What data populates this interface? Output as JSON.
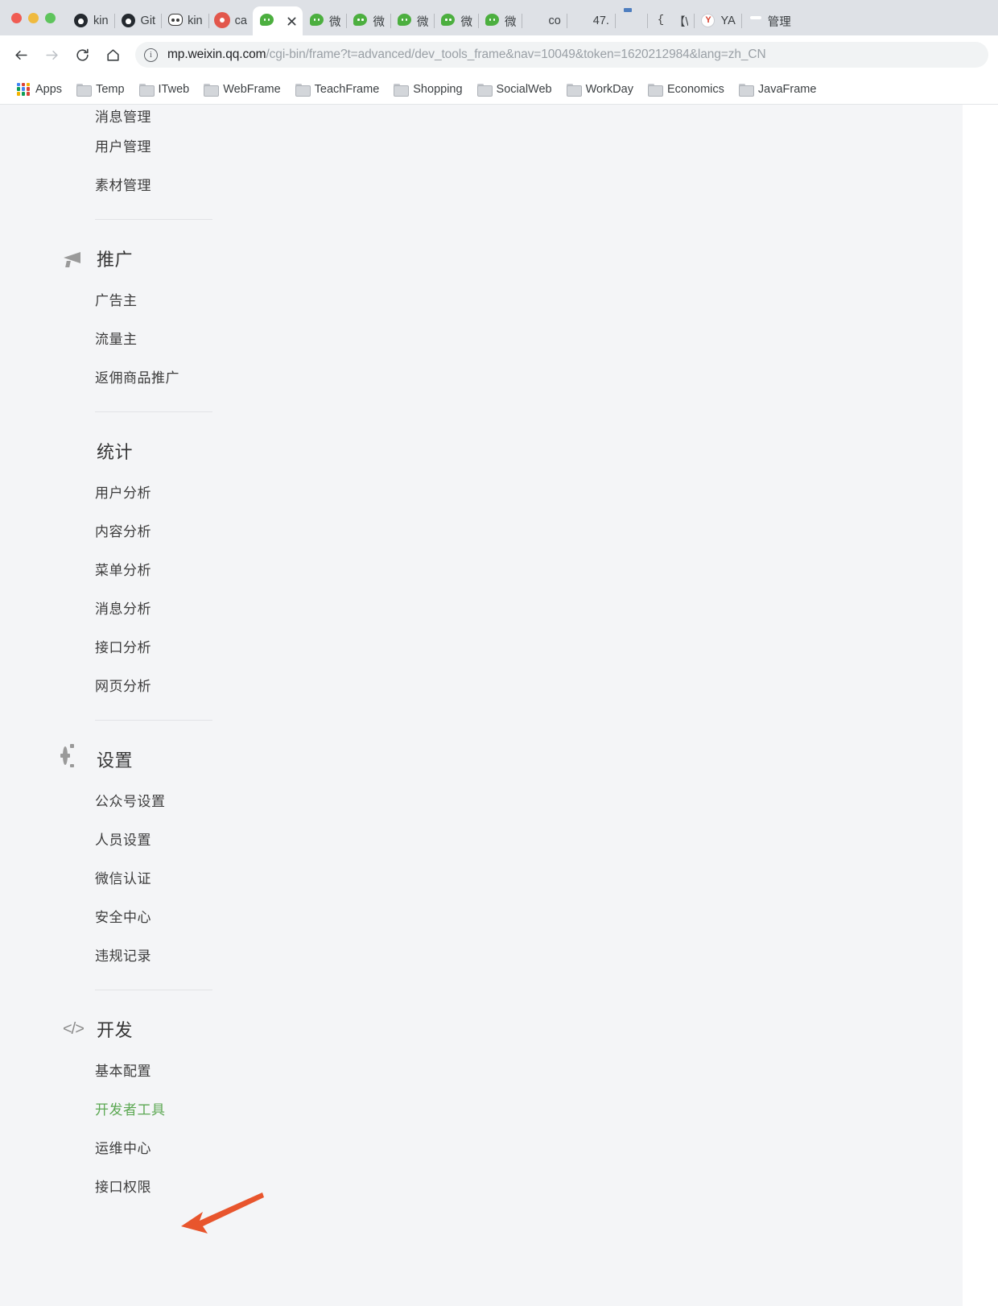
{
  "browser": {
    "window_controls": [
      "close",
      "minimize",
      "maximize"
    ],
    "tabs": [
      {
        "label": "kin",
        "icon": "github-icon",
        "active": false
      },
      {
        "label": "Git",
        "icon": "github-icon",
        "active": false
      },
      {
        "label": "kin",
        "icon": "dog-icon",
        "active": false
      },
      {
        "label": "ca",
        "icon": "gear-red-icon",
        "active": false
      },
      {
        "label": "",
        "icon": "wechat-icon",
        "active": true
      },
      {
        "label": "微",
        "icon": "wechat-icon",
        "active": false
      },
      {
        "label": "微",
        "icon": "wechat-icon",
        "active": false
      },
      {
        "label": "微",
        "icon": "wechat-icon",
        "active": false
      },
      {
        "label": "微",
        "icon": "wechat-icon",
        "active": false
      },
      {
        "label": "微",
        "icon": "wechat-icon",
        "active": false
      },
      {
        "label": "co",
        "icon": "drop-green-icon",
        "active": false
      },
      {
        "label": "47.",
        "icon": "globe-icon",
        "active": false
      },
      {
        "label": "",
        "icon": "java-icon",
        "active": false
      },
      {
        "label": "【\\",
        "icon": "bracket-icon",
        "active": false
      },
      {
        "label": "YA",
        "icon": "yandex-icon",
        "active": false
      },
      {
        "label": "管理",
        "icon": "car-red-icon",
        "active": false
      }
    ],
    "toolbar": {
      "back_label": "Back",
      "forward_label": "Forward",
      "reload_label": "Reload",
      "home_label": "Home",
      "site_info_label": "Site information",
      "url_host": "mp.weixin.qq.com",
      "url_path": "/cgi-bin/frame?t=advanced/dev_tools_frame&nav=10049&token=1620212984&lang=zh_CN"
    },
    "bookmarks": [
      {
        "label": "Apps",
        "icon": "apps-grid-icon"
      },
      {
        "label": "Temp",
        "icon": "folder-icon"
      },
      {
        "label": "ITweb",
        "icon": "folder-icon"
      },
      {
        "label": "WebFrame",
        "icon": "folder-icon"
      },
      {
        "label": "TeachFrame",
        "icon": "folder-icon"
      },
      {
        "label": "Shopping",
        "icon": "folder-icon"
      },
      {
        "label": "SocialWeb",
        "icon": "folder-icon"
      },
      {
        "label": "WorkDay",
        "icon": "folder-icon"
      },
      {
        "label": "Economics",
        "icon": "folder-icon"
      },
      {
        "label": "JavaFrame",
        "icon": "folder-icon"
      }
    ]
  },
  "sidebar": {
    "clipped_top_item": "消息管理",
    "management_items": [
      {
        "label": "用户管理"
      },
      {
        "label": "素材管理"
      }
    ],
    "groups": [
      {
        "title": "推广",
        "icon": "megaphone-icon",
        "items": [
          {
            "label": "广告主"
          },
          {
            "label": "流量主"
          },
          {
            "label": "返佣商品推广"
          }
        ]
      },
      {
        "title": "统计",
        "icon": "pie-chart-icon",
        "items": [
          {
            "label": "用户分析"
          },
          {
            "label": "内容分析"
          },
          {
            "label": "菜单分析"
          },
          {
            "label": "消息分析"
          },
          {
            "label": "接口分析"
          },
          {
            "label": "网页分析"
          }
        ]
      },
      {
        "title": "设置",
        "icon": "gear-icon",
        "items": [
          {
            "label": "公众号设置"
          },
          {
            "label": "人员设置"
          },
          {
            "label": "微信认证"
          },
          {
            "label": "安全中心"
          },
          {
            "label": "违规记录"
          }
        ]
      },
      {
        "title": "开发",
        "icon": "code-brackets-icon",
        "icon_glyph": "</>",
        "items": [
          {
            "label": "基本配置",
            "active": false
          },
          {
            "label": "开发者工具",
            "active": true
          },
          {
            "label": "运维中心",
            "active": false
          },
          {
            "label": "接口权限",
            "active": false
          }
        ]
      }
    ]
  },
  "annotation": {
    "arrow": {
      "name": "red-arrow-pointing-to-developer-tools",
      "color": "#E8552D",
      "target": "开发者工具"
    }
  },
  "colors": {
    "active_green": "#5CA853",
    "page_background": "#F4F5F7",
    "text_primary": "#3C3C3C",
    "group_title": "#353535",
    "arrow": "#E8552D",
    "url_host": "#202124",
    "url_path": "#9AA0A6"
  }
}
